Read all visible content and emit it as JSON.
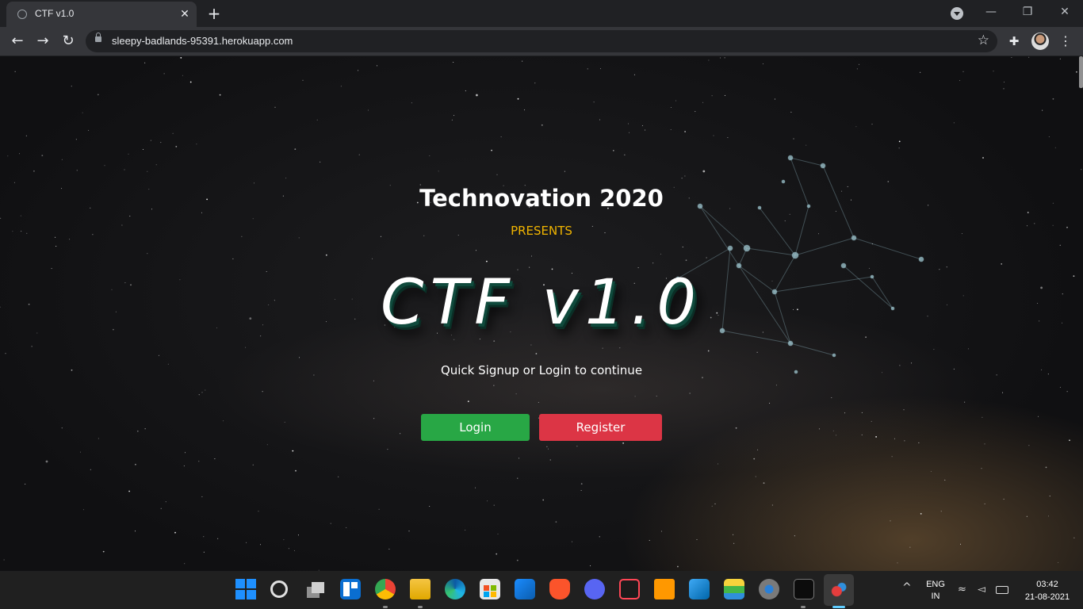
{
  "browser": {
    "tab_title": "CTF v1.0",
    "tab_close_glyph": "✕",
    "new_tab_glyph": "+",
    "url": "sleepy-badlands-95391.herokuapp.com",
    "icons": [
      "globe-icon",
      "close-icon",
      "plus-icon",
      "tab-search-icon",
      "back-icon",
      "forward-icon",
      "reload-icon",
      "lock-icon",
      "star-icon",
      "extensions-icon",
      "profile-avatar",
      "menu-icon"
    ]
  },
  "window_controls": {
    "minimize": "—",
    "restore": "❐",
    "close": "✕"
  },
  "nav": {
    "back": "←",
    "forward": "→",
    "reload": "↻",
    "star": "☆",
    "extensions": "✚",
    "menu": "⋮"
  },
  "page": {
    "title": "Technovation 2020",
    "presents": "PRESENTS",
    "logo": "CTF v1.0",
    "tagline": "Quick Signup or Login to continue",
    "login_label": "Login",
    "register_label": "Register"
  },
  "colors": {
    "presents": "#f0b400",
    "login": "#28a745",
    "register": "#dc3545",
    "logo_shadow": "#0f4a3c"
  },
  "taskbar": {
    "apps": [
      "start",
      "search",
      "task-view",
      "widgets",
      "chrome",
      "file-explorer",
      "edge",
      "store",
      "mail",
      "brave",
      "discord",
      "valorant",
      "sublime-text",
      "vscode",
      "bluestacks",
      "settings",
      "terminal",
      "snipping-tool"
    ],
    "active_app": "snipping-tool",
    "tray_chevron": "^",
    "lang_line1": "ENG",
    "lang_line2": "IN",
    "time": "03:42",
    "date": "21-08-2021"
  }
}
